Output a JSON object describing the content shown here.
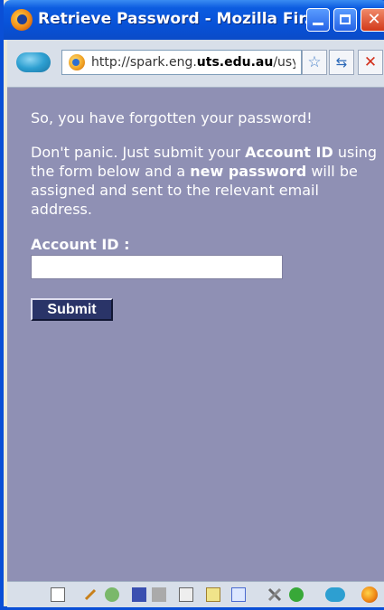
{
  "window": {
    "title": "Retrieve Password - Mozilla Fir...",
    "colors": {
      "titlebar": "#0a4fd6",
      "content_bg": "#8f90b4",
      "button_bg": "#2a3468"
    }
  },
  "navbar": {
    "url_prefix": "http://spark.eng.",
    "url_domain": "uts.edu.au",
    "url_suffix": "/usyc"
  },
  "content": {
    "line1": "So, you have forgotten your password!",
    "p2_a": "Don't panic. Just submit your ",
    "p2_b": "Account ID",
    "p2_c": " using the form below and a ",
    "p2_d": "new password",
    "p2_e": " will be assigned and sent to the relevant email address.",
    "account_label": "Account ID :",
    "account_value": "",
    "submit_label": "Submit"
  },
  "statusbar": {
    "icons": [
      "page-icon",
      "pencil-icon",
      "globe-icon",
      "save-icon",
      "print-icon",
      "edit-icon",
      "note-icon",
      "chart-icon",
      "tools-icon",
      "addon-icon",
      "sync-icon",
      "firefox-icon"
    ]
  }
}
